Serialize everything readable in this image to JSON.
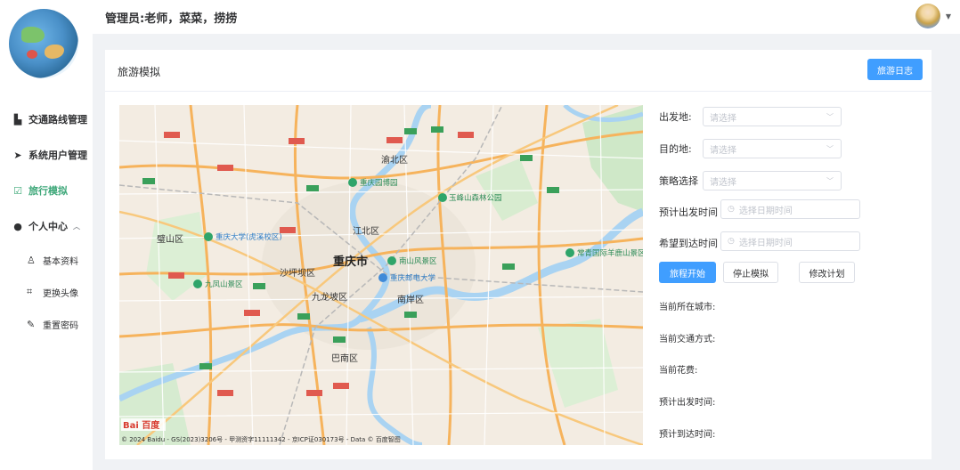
{
  "header": {
    "title": "管理员:老师，菜菜，捞捞"
  },
  "sidebar": {
    "items": [
      {
        "label": "交通路线管理",
        "icon": "doc-icon"
      },
      {
        "label": "系统用户管理",
        "icon": "send-icon"
      },
      {
        "label": "旅行模拟",
        "icon": "edit-icon"
      },
      {
        "label": "个人中心",
        "icon": "user-icon"
      }
    ],
    "submenu": [
      {
        "label": "基本资料",
        "icon": "user-outline-icon"
      },
      {
        "label": "更换头像",
        "icon": "crop-icon"
      },
      {
        "label": "重置密码",
        "icon": "edit-pen-icon"
      }
    ]
  },
  "card": {
    "title": "旅游模拟",
    "log_button": "旅游日志"
  },
  "map": {
    "labels": [
      "重庆市",
      "渝北区",
      "江北区",
      "沙坪坝区",
      "九龙坡区",
      "南岸区",
      "巴南区",
      "璧山区",
      "重庆园博园",
      "玉峰山森林公园",
      "南山风景区",
      "重庆邮电大学",
      "重庆大学(虎溪校区)",
      "九凤山景区",
      "常青国际羊鹿山景区"
    ],
    "copyright": "© 2024 Baidu - GS(2023)3206号 - 甲测资字11111342 - 京ICP证030173号 - Data © 百度智图",
    "logo_text": "Bai 百度"
  },
  "form": {
    "origin": {
      "label": "出发地:",
      "placeholder": "请选择"
    },
    "destination": {
      "label": "目的地:",
      "placeholder": "请选择"
    },
    "strategy": {
      "label": "策略选择",
      "placeholder": "请选择"
    },
    "depart_time": {
      "label": "预计出发时间",
      "placeholder": "选择日期时间"
    },
    "arrive_time": {
      "label": "希望到达时间",
      "placeholder": "选择日期时间"
    },
    "buttons": {
      "start": "旅程开始",
      "stop": "停止模拟",
      "modify": "修改计划"
    },
    "info": {
      "city": "当前所在城市:",
      "transport": "当前交通方式:",
      "cost": "当前花费:",
      "depart": "预计出发时间:",
      "arrive": "预计到达时间:"
    }
  },
  "colors": {
    "accent": "#409eff",
    "active_menu": "#3fa87a"
  }
}
